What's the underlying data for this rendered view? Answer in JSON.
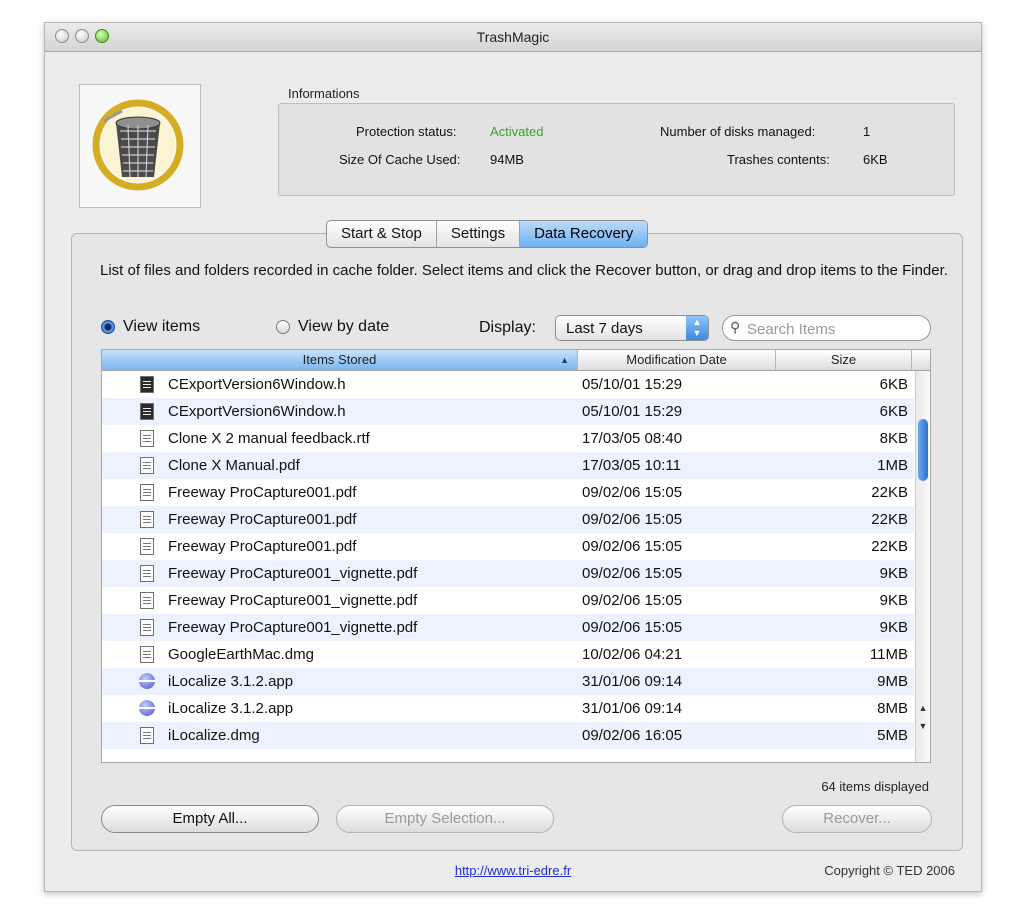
{
  "window": {
    "title": "TrashMagic"
  },
  "icons": {
    "app": "trash-basket-icon",
    "search": "magnifier-icon"
  },
  "info": {
    "section_label": "Informations",
    "protection_status_label": "Protection status:",
    "protection_status_value": "Activated",
    "disks_label": "Number of disks managed:",
    "disks_value": "1",
    "cache_label": "Size Of Cache Used:",
    "cache_value": "94MB",
    "trashes_label": "Trashes contents:",
    "trashes_value": "6KB",
    "status_color": "#3aa02c"
  },
  "tabs": [
    {
      "label": "Start & Stop",
      "selected": false
    },
    {
      "label": "Settings",
      "selected": false
    },
    {
      "label": "Data Recovery",
      "selected": true
    }
  ],
  "description": "List of files and folders recorded in cache folder. Select items and click the Recover button, or drag and drop items to the Finder.",
  "view": {
    "items_label": "View items",
    "by_date_label": "View by date",
    "selected": "items"
  },
  "display": {
    "label": "Display:",
    "value": "Last 7 days"
  },
  "search": {
    "placeholder": "Search Items",
    "value": ""
  },
  "table": {
    "columns": [
      "Items Stored",
      "Modification Date",
      "Size"
    ],
    "sorted_column": "Items Stored",
    "rows": [
      {
        "name": "CExportVersion6Window.h",
        "date": "05/10/01 15:29",
        "size": "6KB",
        "icon": "header-file-icon"
      },
      {
        "name": "CExportVersion6Window.h",
        "date": "05/10/01 15:29",
        "size": "6KB",
        "icon": "header-file-icon"
      },
      {
        "name": "Clone X 2 manual feedback.rtf",
        "date": "17/03/05 08:40",
        "size": "8KB",
        "icon": "document-icon"
      },
      {
        "name": "Clone X Manual.pdf",
        "date": "17/03/05 10:11",
        "size": "1MB",
        "icon": "pdf-icon"
      },
      {
        "name": "Freeway ProCapture001.pdf",
        "date": "09/02/06 15:05",
        "size": "22KB",
        "icon": "pdf-icon"
      },
      {
        "name": "Freeway ProCapture001.pdf",
        "date": "09/02/06 15:05",
        "size": "22KB",
        "icon": "pdf-icon"
      },
      {
        "name": "Freeway ProCapture001.pdf",
        "date": "09/02/06 15:05",
        "size": "22KB",
        "icon": "pdf-icon"
      },
      {
        "name": "Freeway ProCapture001_vignette.pdf",
        "date": "09/02/06 15:05",
        "size": "9KB",
        "icon": "pdf-icon"
      },
      {
        "name": "Freeway ProCapture001_vignette.pdf",
        "date": "09/02/06 15:05",
        "size": "9KB",
        "icon": "pdf-icon"
      },
      {
        "name": "Freeway ProCapture001_vignette.pdf",
        "date": "09/02/06 15:05",
        "size": "9KB",
        "icon": "pdf-icon"
      },
      {
        "name": "GoogleEarthMac.dmg",
        "date": "10/02/06 04:21",
        "size": "11MB",
        "icon": "disk-image-icon"
      },
      {
        "name": "iLocalize 3.1.2.app",
        "date": "31/01/06 09:14",
        "size": "9MB",
        "icon": "application-icon"
      },
      {
        "name": "iLocalize 3.1.2.app",
        "date": "31/01/06 09:14",
        "size": "8MB",
        "icon": "application-icon"
      },
      {
        "name": "iLocalize.dmg",
        "date": "09/02/06 16:05",
        "size": "5MB",
        "icon": "disk-image-icon"
      }
    ]
  },
  "status": {
    "items_displayed": "64 items displayed"
  },
  "buttons": {
    "empty_all": "Empty All...",
    "empty_selection": "Empty Selection...",
    "recover": "Recover..."
  },
  "footer": {
    "link": "http://www.tri-edre.fr",
    "copyright": "Copyright © TED 2006"
  }
}
